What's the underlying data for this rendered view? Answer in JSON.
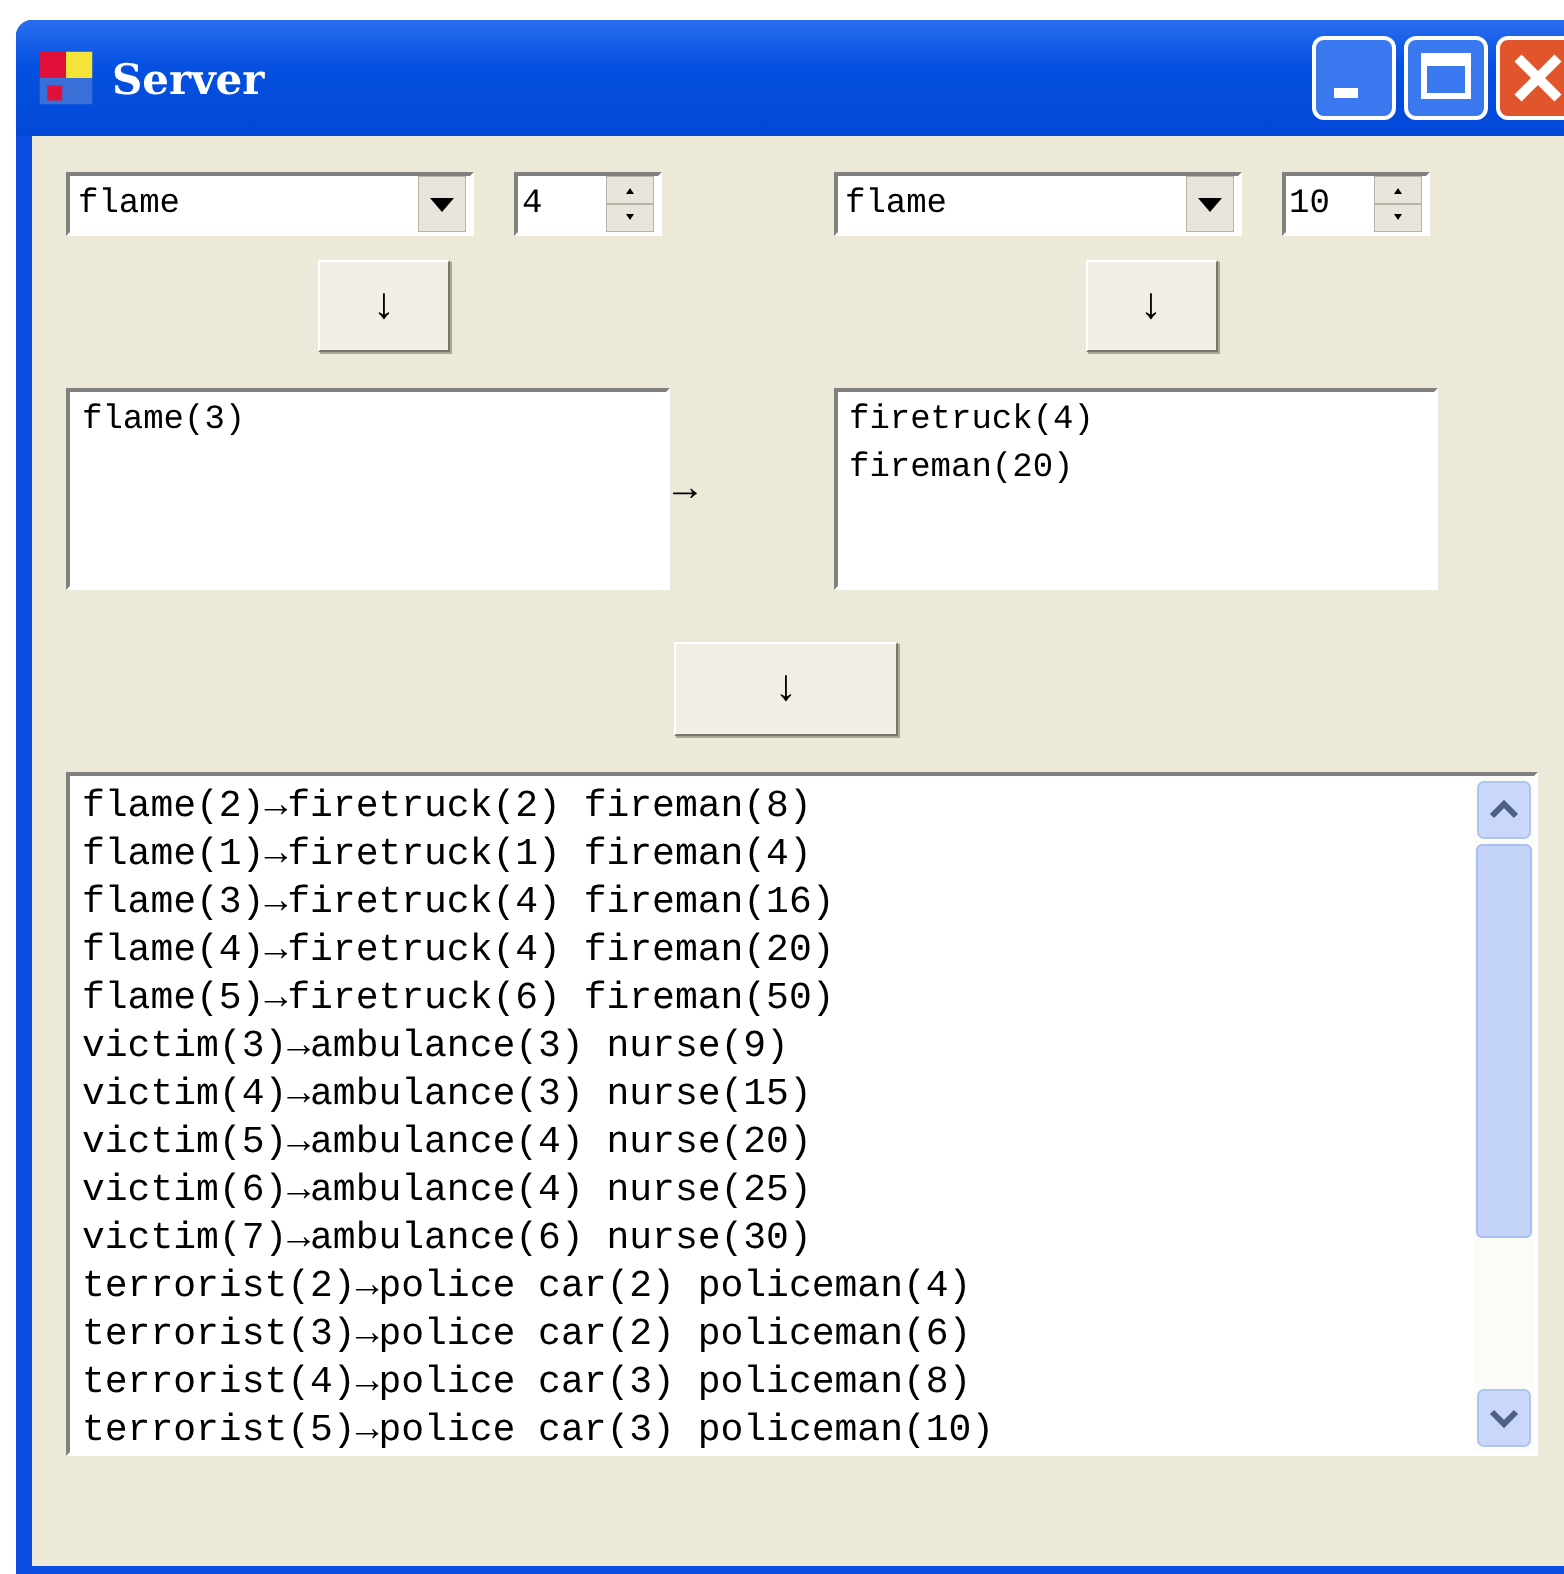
{
  "window": {
    "title": "Server"
  },
  "left": {
    "combo": "flame",
    "spin": "4",
    "button": "↓",
    "list": [
      "flame(3)"
    ]
  },
  "middle_arrow": "→",
  "right": {
    "combo": "flame",
    "spin": "10",
    "button": "↓",
    "list": [
      "firetruck(4)",
      "fireman(20)"
    ]
  },
  "center_button": "↓",
  "log": [
    "flame(2)→firetruck(2) fireman(8)",
    "flame(1)→firetruck(1) fireman(4)",
    "flame(3)→firetruck(4) fireman(16)",
    "flame(4)→firetruck(4) fireman(20)",
    "flame(5)→firetruck(6) fireman(50)",
    "victim(3)→ambulance(3) nurse(9)",
    "victim(4)→ambulance(3) nurse(15)",
    "victim(5)→ambulance(4) nurse(20)",
    "victim(6)→ambulance(4) nurse(25)",
    "victim(7)→ambulance(6) nurse(30)",
    "terrorist(2)→police car(2) policeman(4)",
    "terrorist(3)→police car(2) policeman(6)",
    "terrorist(4)→police car(3) policeman(8)",
    "terrorist(5)→police car(3) policeman(10)"
  ]
}
